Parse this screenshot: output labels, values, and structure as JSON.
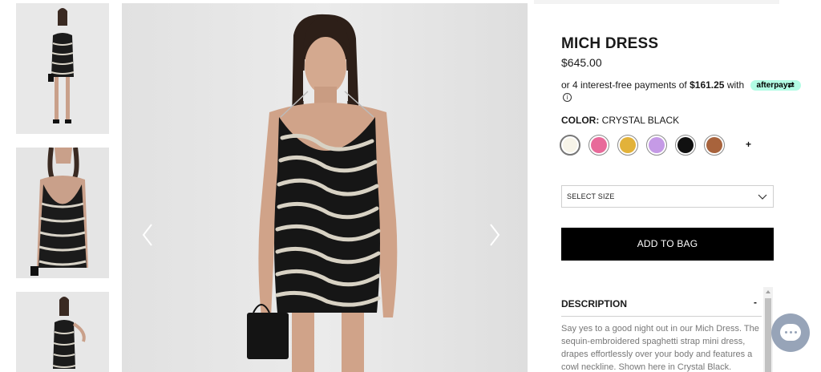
{
  "product": {
    "title": "MICH DRESS",
    "price": "$645.00",
    "afterpay": {
      "prefix": "or 4 interest-free payments of",
      "amount": "$161.25",
      "suffix": "with",
      "badge": "afterpay"
    },
    "color_label": "COLOR:",
    "color_value": "CRYSTAL BLACK",
    "swatches": [
      {
        "name": "cream",
        "color": "#f7f4e8",
        "selected": true
      },
      {
        "name": "pink",
        "color": "#e86a9a",
        "selected": false
      },
      {
        "name": "gold",
        "color": "#e2b23a",
        "selected": false
      },
      {
        "name": "lilac",
        "color": "#c59ae6",
        "selected": false
      },
      {
        "name": "black",
        "color": "#111111",
        "selected": false
      },
      {
        "name": "bronze",
        "color": "#a8633c",
        "selected": false
      }
    ],
    "more_swatches": "+",
    "size_select_label": "SELECT SIZE",
    "add_to_bag": "ADD TO BAG",
    "description": {
      "header": "DESCRIPTION",
      "toggle": "-",
      "text": "Say yes to a good night out in our Mich Dress. The sequin-embroidered spaghetti strap mini dress, drapes effortlessly over your body and features a cowl neckline. Shown here in Crystal Black."
    }
  },
  "gallery": {
    "thumbnail_count": 3,
    "prev_icon": "chevron-left-icon",
    "next_icon": "chevron-right-icon"
  },
  "chat": {
    "icon": "chat-bubble-icon",
    "color": "#97a4b8"
  },
  "colors": {
    "button_bg": "#000000",
    "afterpay_badge": "#b2fce4"
  }
}
